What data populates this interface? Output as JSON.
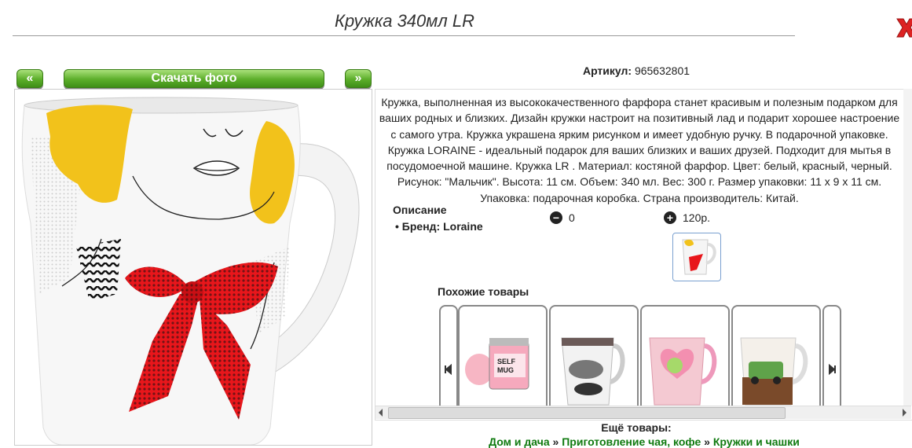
{
  "title": "Кружка 340мл LR",
  "nav": {
    "prev_label": "«",
    "download_label": "Скачать фото",
    "next_label": "»"
  },
  "artikul": {
    "label": "Артикул:",
    "value": "965632801"
  },
  "description": "Кружка, выполненная из высококачественного фарфора станет красивым и полезным подарком для ваших родных и близких. Дизайн кружки настроит на позитивный лад и подарит хорошее настроение с самого утра. Кружка украшена ярким рисунком и имеет удобную ручку. В подарочной упаковке. Кружка LORAINE - идеальный подарок для ваших близких и ваших друзей. Подходит для мытья в посудомоечной машине. Кружка LR . Материал: костяной фарфор. Цвет: белый, красный, черный. Рисунок: \"Мальчик\". Высота: 11 см. Объем: 340 мл. Вес: 300 г. Размер упаковки: 11 х 9 х 11 см. Упаковка: подарочная коробка. Страна производитель: Китай.",
  "specs": {
    "heading": "Описание",
    "brand": "Бренд: Loraine"
  },
  "votes": {
    "minus": "0",
    "plus": "120р."
  },
  "similar": {
    "heading": "Похожие товары"
  },
  "more": {
    "heading": "Ещё товары:"
  },
  "breadcrumbs": {
    "item1": "Дом и дача",
    "sep": "»",
    "item2": "Приготовление чая, кофе",
    "item3": "Кружки и чашки"
  },
  "colors": {
    "accent": "#4caf2a",
    "link": "#0f7a0f",
    "close": "#d22"
  }
}
